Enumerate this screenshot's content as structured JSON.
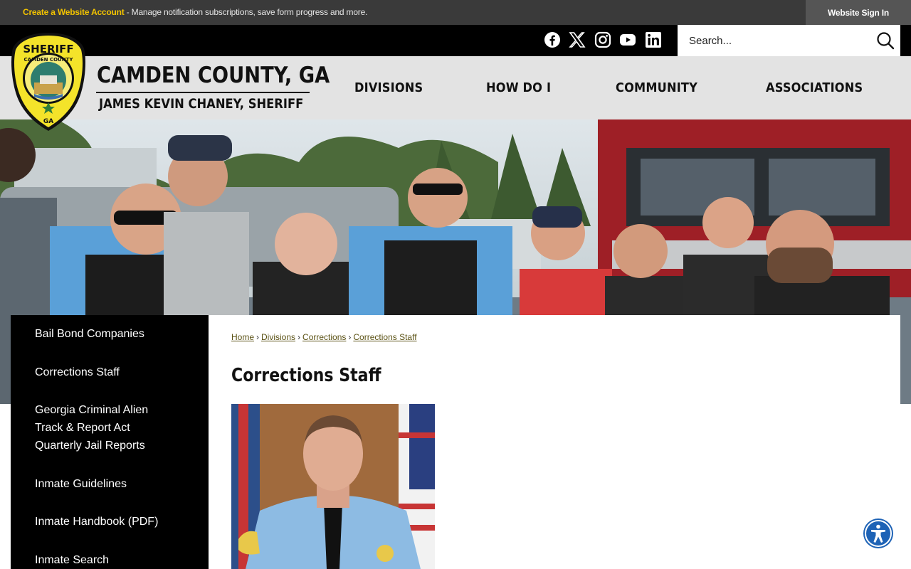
{
  "topbar": {
    "create_account": "Create a Website Account",
    "message": " - Manage notification subscriptions, save form progress and more.",
    "sign_in": "Website Sign In"
  },
  "social": [
    "facebook-icon",
    "x-icon",
    "instagram-icon",
    "youtube-icon",
    "linkedin-icon"
  ],
  "search": {
    "placeholder": "Search..."
  },
  "brand": {
    "badge_top": "SHERIFF",
    "badge_ring": "CAMDEN COUNTY",
    "badge_bottom": "GA",
    "title": "CAMDEN COUNTY, GA",
    "subtitle": "JAMES KEVIN CHANEY, SHERIFF"
  },
  "nav": [
    "DIVISIONS",
    "HOW DO I",
    "COMMUNITY",
    "ASSOCIATIONS"
  ],
  "sidemenu": [
    "Bail Bond Companies",
    "Corrections Staff",
    "Georgia Criminal Alien Track & Report Act Quarterly Jail Reports",
    "Inmate Guidelines",
    "Inmate Handbook (PDF)",
    "Inmate Search"
  ],
  "breadcrumb": [
    "Home",
    "Divisions",
    "Corrections",
    "Corrections Staff"
  ],
  "page_title": "Corrections Staff",
  "colors": {
    "accent": "#f2c300",
    "topbar": "#3a3a3a",
    "header": "#e3e3e3",
    "link": "#5b5215"
  }
}
